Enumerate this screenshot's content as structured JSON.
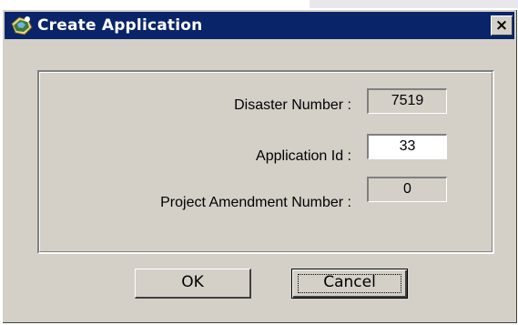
{
  "window": {
    "title": "Create Application",
    "close_glyph": "×",
    "icon": "app-folder-icon"
  },
  "fields": [
    {
      "label": "Disaster Number :",
      "value": "7519",
      "editable": false
    },
    {
      "label": "Application Id :",
      "value": "33",
      "editable": true
    },
    {
      "label": "Project Amendment Number :",
      "value": "0",
      "editable": false
    }
  ],
  "buttons": {
    "ok": "OK",
    "cancel": "Cancel"
  },
  "colors": {
    "titlebar": "#0a246a",
    "face": "#d4d0c8"
  }
}
